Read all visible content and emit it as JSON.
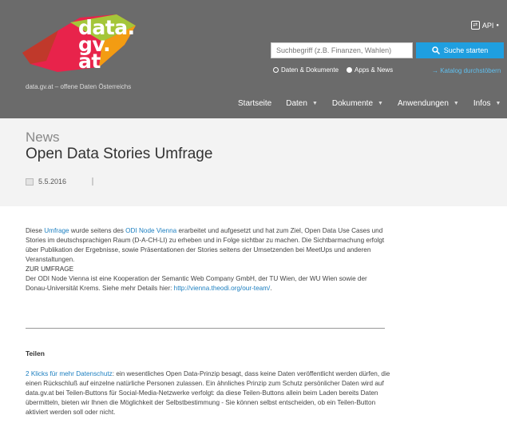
{
  "header": {
    "logo": {
      "line1": "data.",
      "line2": "gv.",
      "line3": "at"
    },
    "tagline": "data.gv.at – offene Daten Österreichs",
    "api_label": "API",
    "search": {
      "placeholder": "Suchbegriff (z.B. Finanzen, Wahlen)",
      "button_label": "Suche starten",
      "scope_options": [
        "Daten & Dokumente",
        "Apps & News"
      ],
      "selected_scope": "Apps & News",
      "catalog_link": "→ Katalog durchstöbern"
    },
    "nav": [
      {
        "label": "Startseite",
        "has_menu": false
      },
      {
        "label": "Daten",
        "has_menu": true
      },
      {
        "label": "Dokumente",
        "has_menu": true
      },
      {
        "label": "Anwendungen",
        "has_menu": true
      },
      {
        "label": "Infos",
        "has_menu": true
      }
    ]
  },
  "article": {
    "section": "News",
    "title": "Open Data Stories Umfrage",
    "date": "5.5.2016",
    "p1_before": "Diese ",
    "p1_link1": "Umfrage",
    "p1_mid": " wurde seitens des ",
    "p1_link2": "ODI Node Vienna",
    "p1_after": " erarbeitet und aufgesetzt und hat zum Ziel, Open Data Use Cases und Stories im deutschsprachigen Raum (D-A-CH-LI) zu erheben und in Folge sichtbar zu machen. Die Sichtbarmachung erfolgt über Publikation der Ergebnisse, sowie Präsentationen der Stories seitens der Umsetzenden bei MeetUps und anderen Veranstaltungen.",
    "survey_heading": "ZUR UMFRAGE",
    "p2_before": "Der ODI Node Vienna ist eine Kooperation der Semantic Web Company GmbH, der TU Wien, der WU Wien sowie der Donau-Universität Krems. Siehe mehr Details hier: ",
    "p2_link": "http://vienna.theodi.org/our-team/",
    "p2_after": ".",
    "share_title": "Teilen",
    "share_link": "2 Klicks für mehr Datenschutz",
    "share_text": ": ein wesentliches Open Data-Prinzip besagt, dass keine Daten veröffentlicht werden dürfen, die einen Rückschluß auf einzelne natürliche Personen zulassen. Ein ähnliches Prinzip zum Schutz persönlicher Daten wird auf data.gv.at bei Teilen-Buttons für Social-Media-Netzwerke verfolgt: da diese Teilen-Buttons allein beim Laden bereits Daten übermitteln, bieten wir Ihnen die Möglichkeit der Selbstbestimmung - Sie können selbst entscheiden, ob ein Teilen-Button aktiviert werden soll oder nicht."
  },
  "colors": {
    "header_bg": "#6b6b6b",
    "search_button": "#1f9fe0",
    "link": "#1c7fc0",
    "title_band_bg": "#f3f3f3",
    "logo_colors": [
      "#e8234b",
      "#a4c639",
      "#f39c12",
      "#c0392b"
    ]
  }
}
